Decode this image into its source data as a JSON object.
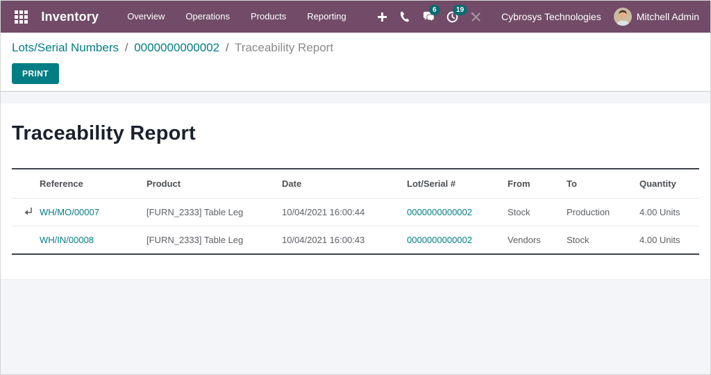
{
  "colors": {
    "navbar": "#714B67",
    "accent": "#017e84",
    "badge": "#0c6a70"
  },
  "app": {
    "name": "Inventory",
    "menu": [
      "Overview",
      "Operations",
      "Products",
      "Reporting"
    ],
    "badges": {
      "messages": "6",
      "activities": "19"
    },
    "company": "Cybrosys Technologies",
    "user": "Mitchell Admin"
  },
  "breadcrumb": {
    "lot_list_label": "Lots/Serial Numbers",
    "lot_number": "0000000000002",
    "current": "Traceability Report",
    "separator": "/"
  },
  "toolbar": {
    "print_label": "PRINT"
  },
  "report": {
    "title": "Traceability Report"
  },
  "table": {
    "headers": [
      "Reference",
      "Product",
      "Date",
      "Lot/Serial #",
      "From",
      "To",
      "Quantity"
    ],
    "rows": [
      {
        "reference": "WH/MO/00007",
        "product": "[FURN_2333] Table Leg",
        "date": "10/04/2021 16:00:44",
        "lot": "0000000000002",
        "from": "Stock",
        "to": "Production",
        "quantity": "4.00 Units"
      },
      {
        "reference": "WH/IN/00008",
        "product": "[FURN_2333] Table Leg",
        "date": "10/04/2021 16:00:43",
        "lot": "0000000000002",
        "from": "Vendors",
        "to": "Stock",
        "quantity": "4.00 Units"
      }
    ]
  }
}
